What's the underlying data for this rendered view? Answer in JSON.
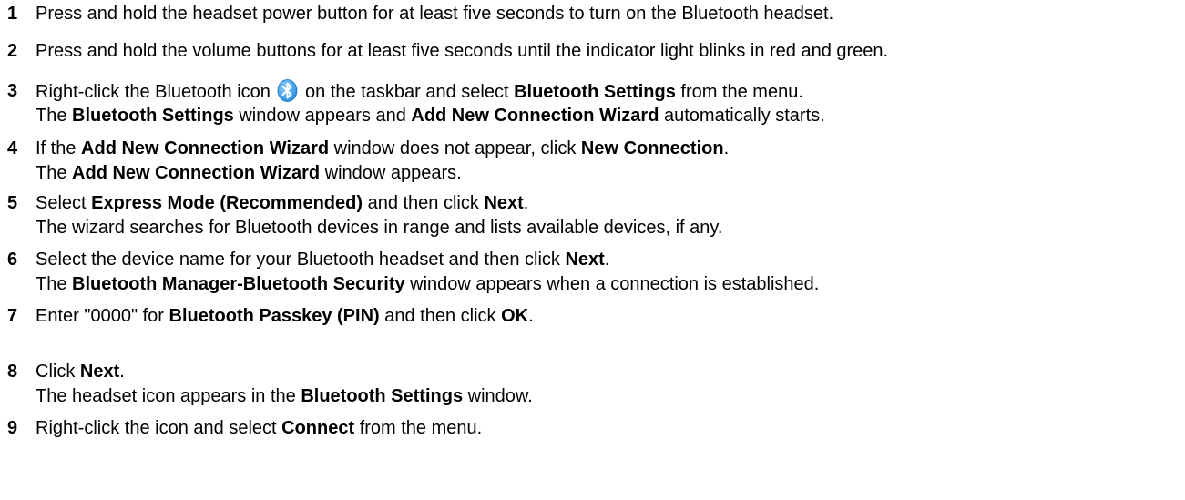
{
  "steps": [
    {
      "number": "1",
      "lines": [
        [
          {
            "t": "Press and hold the headset power button for at least five seconds to turn on the Bluetooth headset.",
            "b": false
          }
        ]
      ]
    },
    {
      "number": "2",
      "lines": [
        [
          {
            "t": "Press and hold the volume buttons for at least five seconds until the indicator light blinks in red and green.",
            "b": false
          }
        ]
      ]
    },
    {
      "number": "3",
      "lines": [
        [
          {
            "t": "Right-click the Bluetooth icon ",
            "b": false
          },
          {
            "icon": "bluetooth-icon"
          },
          {
            "t": " on the taskbar and select ",
            "b": false
          },
          {
            "t": "Bluetooth Settings",
            "b": true
          },
          {
            "t": " from the menu.",
            "b": false
          }
        ],
        [
          {
            "t": "The ",
            "b": false
          },
          {
            "t": "Bluetooth Settings",
            "b": true
          },
          {
            "t": " window appears and ",
            "b": false
          },
          {
            "t": "Add New Connection Wizard",
            "b": true
          },
          {
            "t": " automatically starts.",
            "b": false
          }
        ]
      ]
    },
    {
      "number": "4",
      "lines": [
        [
          {
            "t": "If the ",
            "b": false
          },
          {
            "t": "Add New Connection Wizard",
            "b": true
          },
          {
            "t": " window does not appear, click ",
            "b": false
          },
          {
            "t": "New Connection",
            "b": true
          },
          {
            "t": ".",
            "b": false
          }
        ],
        [
          {
            "t": "The ",
            "b": false
          },
          {
            "t": "Add New Connection Wizard",
            "b": true
          },
          {
            "t": " window appears.",
            "b": false
          }
        ]
      ]
    },
    {
      "number": "5",
      "lines": [
        [
          {
            "t": "Select ",
            "b": false
          },
          {
            "t": "Express Mode (Recommended)",
            "b": true
          },
          {
            "t": " and then click ",
            "b": false
          },
          {
            "t": "Next",
            "b": true
          },
          {
            "t": ".",
            "b": false
          }
        ],
        [
          {
            "t": "The wizard searches for Bluetooth devices in range and lists available devices, if any.",
            "b": false
          }
        ]
      ]
    },
    {
      "number": "6",
      "lines": [
        [
          {
            "t": "Select the device name for your Bluetooth headset and then click ",
            "b": false
          },
          {
            "t": "Next",
            "b": true
          },
          {
            "t": ".",
            "b": false
          }
        ],
        [
          {
            "t": "The ",
            "b": false
          },
          {
            "t": "Bluetooth Manager-Bluetooth Security",
            "b": true
          },
          {
            "t": " window appears when a connection is established.",
            "b": false
          }
        ]
      ]
    },
    {
      "number": "7",
      "lines": [
        [
          {
            "t": "Enter \"0000\" for ",
            "b": false
          },
          {
            "t": "Bluetooth Passkey (PIN)",
            "b": true
          },
          {
            "t": " and then click ",
            "b": false
          },
          {
            "t": "OK",
            "b": true
          },
          {
            "t": ".",
            "b": false
          }
        ]
      ]
    },
    {
      "number": "8",
      "lines": [
        [
          {
            "t": "Click ",
            "b": false
          },
          {
            "t": "Next",
            "b": true
          },
          {
            "t": ".",
            "b": false
          }
        ],
        [
          {
            "t": "The headset icon appears in the ",
            "b": false
          },
          {
            "t": "Bluetooth Settings",
            "b": true
          },
          {
            "t": " window.",
            "b": false
          }
        ]
      ]
    },
    {
      "number": "9",
      "lines": [
        [
          {
            "t": "Right-click the icon and select ",
            "b": false
          },
          {
            "t": "Connect",
            "b": true
          },
          {
            "t": " from the menu.",
            "b": false
          }
        ]
      ]
    }
  ],
  "colors": {
    "text": "#000000",
    "bluetooth_icon": "#2b8fe0"
  }
}
